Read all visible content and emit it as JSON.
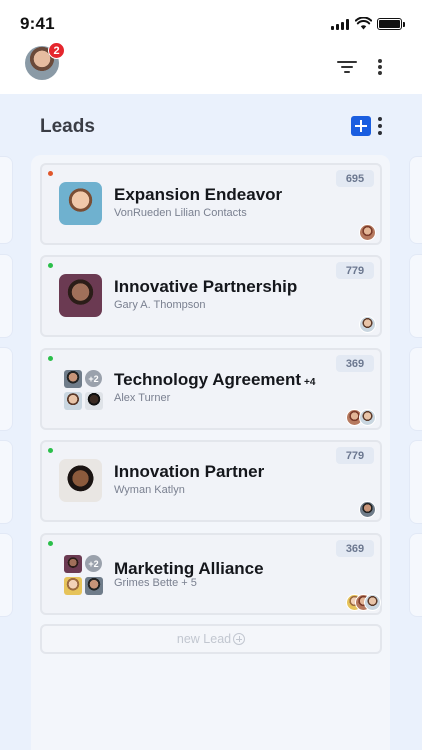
{
  "status_bar": {
    "time": "9:41"
  },
  "header": {
    "notification_count": "2"
  },
  "board": {
    "title": "Leads",
    "new_lead_label": "new Lead"
  },
  "cards": [
    {
      "title": "Expansion Endeavor",
      "subtitle": "VonRueden Lilian Contacts",
      "count": "695",
      "status_color": "#e0572b"
    },
    {
      "title": "Innovative Partnership",
      "subtitle": "Gary A. Thompson",
      "count": "779",
      "status_color": "#2bbf4a"
    },
    {
      "title": "Technology Agreement",
      "title_extra": "+4",
      "subtitle": "Alex Turner",
      "count": "369",
      "status_color": "#2bbf4a",
      "more_avatars": "+2"
    },
    {
      "title": "Innovation Partner",
      "subtitle": "Wyman Katlyn",
      "count": "779",
      "status_color": "#2bbf4a"
    },
    {
      "title": "Marketing Alliance",
      "subtitle": "Grimes Bette + 5",
      "count": "369",
      "status_color": "#2bbf4a",
      "more_avatars": "+2"
    }
  ],
  "icons": {
    "filter": "filter-icon",
    "more": "more-vertical-icon",
    "add": "plus-square-icon",
    "new_lead": "plus-circle-icon"
  }
}
